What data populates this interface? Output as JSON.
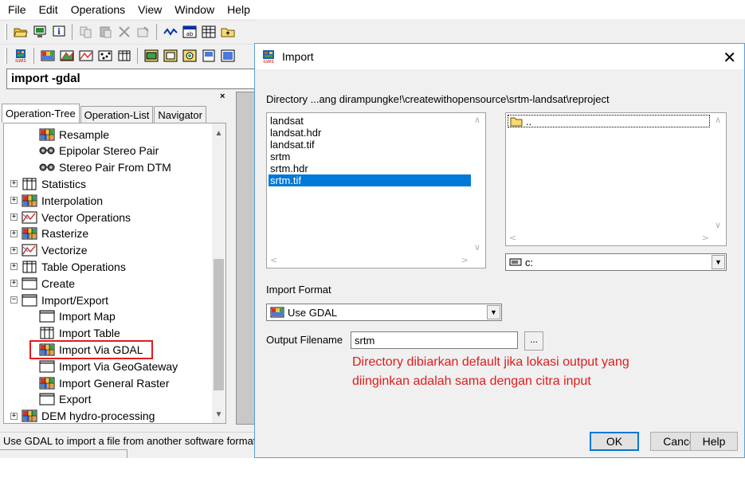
{
  "menu": [
    "File",
    "Edit",
    "Operations",
    "View",
    "Window",
    "Help"
  ],
  "command_line": "import -gdal",
  "panel": {
    "close_glyph": "×",
    "tabs": [
      "Operation-Tree",
      "Operation-List",
      "Navigator"
    ],
    "tree": [
      {
        "label": "Resample",
        "icon": "raster-grid-icon",
        "level": 2
      },
      {
        "label": "Epipolar Stereo Pair",
        "icon": "stereo-glasses-icon",
        "level": 2
      },
      {
        "label": "Stereo Pair From DTM",
        "icon": "stereo-glasses-icon",
        "level": 2
      },
      {
        "label": "Statistics",
        "icon": "table-icon",
        "level": 1,
        "expander": "+"
      },
      {
        "label": "Interpolation",
        "icon": "raster-grid-icon",
        "level": 1,
        "expander": "+"
      },
      {
        "label": "Vector Operations",
        "icon": "vector-icon",
        "level": 1,
        "expander": "+"
      },
      {
        "label": "Rasterize",
        "icon": "raster-grid-icon",
        "level": 1,
        "expander": "+"
      },
      {
        "label": "Vectorize",
        "icon": "vector-icon",
        "level": 1,
        "expander": "+"
      },
      {
        "label": "Table Operations",
        "icon": "table-icon",
        "level": 1,
        "expander": "+"
      },
      {
        "label": "Create",
        "icon": "window-icon",
        "level": 1,
        "expander": "+"
      },
      {
        "label": "Import/Export",
        "icon": "window-icon",
        "level": 1,
        "expander": "−"
      },
      {
        "label": "Import Map",
        "icon": "window-icon",
        "level": 2
      },
      {
        "label": "Import Table",
        "icon": "table-icon",
        "level": 2
      },
      {
        "label": "Import Via GDAL",
        "icon": "raster-grid-icon",
        "level": 2,
        "highlighted": true
      },
      {
        "label": "Import Via GeoGateway",
        "icon": "window-icon",
        "level": 2
      },
      {
        "label": "Import General Raster",
        "icon": "raster-grid-icon",
        "level": 2
      },
      {
        "label": "Export",
        "icon": "window-icon",
        "level": 2
      },
      {
        "label": "DEM hydro-processing",
        "icon": "raster-grid-icon",
        "level": 1,
        "expander": "+"
      }
    ]
  },
  "status_text": "Use GDAL to import a file from another software format",
  "dialog": {
    "title": "Import",
    "close_glyph": "✕",
    "directory_label": "Directory ...ang dirampungke!\\createwithopensource\\srtm-landsat\\reproject",
    "files": [
      "landsat",
      "landsat.hdr",
      "landsat.tif",
      "srtm",
      "srtm.hdr",
      "srtm.tif"
    ],
    "selected_file": "srtm.tif",
    "dirs": [
      ".."
    ],
    "drive": "c:",
    "import_format_label": "Import Format",
    "import_format_value": "Use GDAL",
    "output_filename_label": "Output Filename",
    "output_filename_value": "srtm",
    "browse_label": "...",
    "annotation": "Directory dibiarkan default jika lokasi output yang diinginkan adalah sama dengan citra input",
    "buttons": {
      "ok": "OK",
      "cancel": "Cancel",
      "help": "Help"
    }
  },
  "colors": {
    "highlight": "#e01c1c",
    "selection": "#0078d7",
    "annotation": "#e01c1c"
  }
}
